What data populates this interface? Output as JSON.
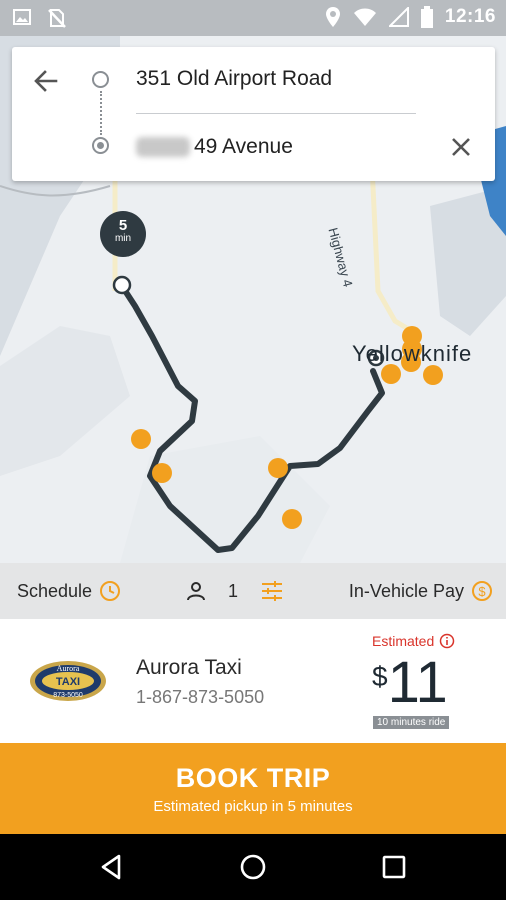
{
  "status_bar": {
    "time": "12:16",
    "left_icons": [
      "image-icon",
      "no-sim-icon"
    ],
    "right_icons": [
      "location-icon",
      "wifi-icon",
      "signal-icon",
      "battery-icon"
    ]
  },
  "map": {
    "city_label": "Yellowknife",
    "highway_label": "Highway 4",
    "eta": {
      "value": "5",
      "unit": "min"
    }
  },
  "route": {
    "pickup": "351 Old Airport Road",
    "dropoff": "49 Avenue"
  },
  "options": {
    "schedule_label": "Schedule",
    "passengers": "1",
    "payment_label": "In-Vehicle Pay"
  },
  "provider": {
    "name": "Aurora Taxi",
    "phone": "1-867-873-5050",
    "estimated_label": "Estimated",
    "currency": "$",
    "price": "11",
    "ride_time": "10 minutes ride",
    "logo_text_top": "Aurora",
    "logo_text_mid": "TAXI",
    "logo_text_bottom": "873-5050"
  },
  "book": {
    "title": "BOOK TRIP",
    "subtitle": "Estimated pickup in 5 minutes"
  },
  "colors": {
    "accent": "#f2a01f",
    "route": "#2f3a41",
    "estimated": "#d9342b"
  }
}
